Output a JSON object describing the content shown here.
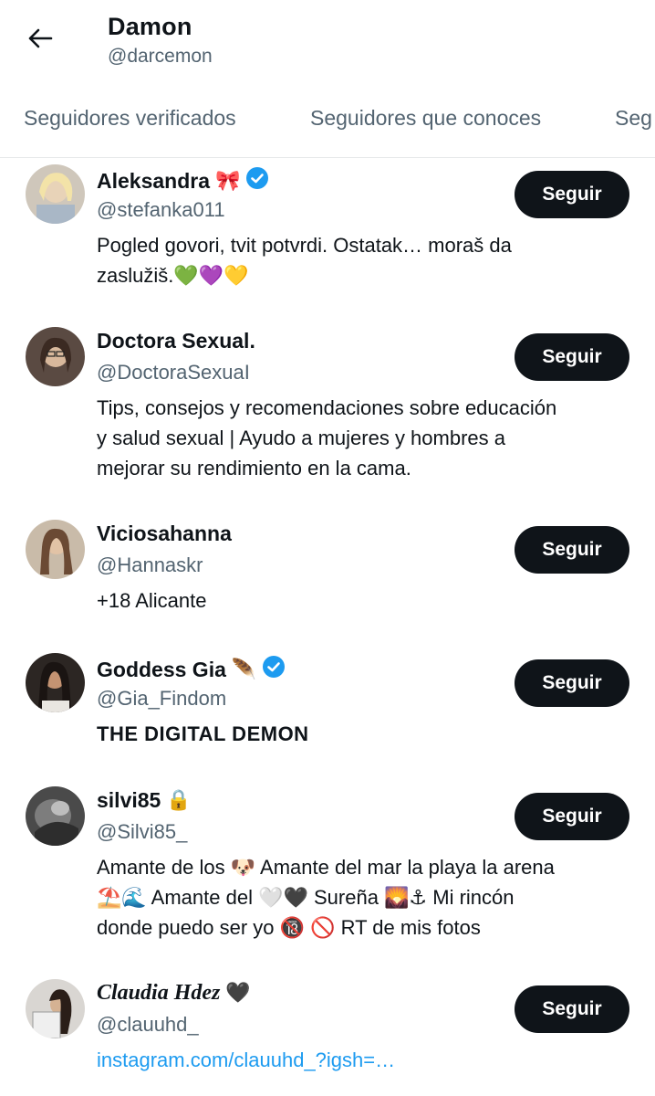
{
  "header": {
    "name": "Damon",
    "handle": "@darcemon"
  },
  "tabs": [
    {
      "label": "Seguidores verificados"
    },
    {
      "label": "Seguidores que conoces"
    },
    {
      "label": "Seg"
    }
  ],
  "follow_label": "Seguir",
  "users": [
    {
      "name": "Aleksandra",
      "name_emoji": "🎀",
      "verified": true,
      "handle": "@stefanka011",
      "bio_lines": [
        "Pogled govori, tvit potvrdi. Ostatak… moraš da",
        "zaslužiš.💚💜💛"
      ]
    },
    {
      "name": "Doctora Sexual.",
      "verified": false,
      "handle": "@DoctoraSexuaI",
      "bio_lines": [
        "Tips, consejos y recomendaciones sobre educación",
        "y salud sexual | Ayudo a mujeres y hombres a",
        "mejorar su rendimiento en la cama."
      ]
    },
    {
      "name": "Viciosahanna",
      "verified": false,
      "handle": "@Hannaskr",
      "bio_lines": [
        "+18 Alicante"
      ]
    },
    {
      "name": "Goddess Gia",
      "name_emoji": "🪶",
      "verified": true,
      "handle": "@Gia_Findom",
      "bio_lines": [
        "THE DIGITAL DEMON"
      ]
    },
    {
      "name": "silvi85",
      "name_emoji": "🔒",
      "verified": false,
      "handle": "@Silvi85_",
      "bio_lines": [
        "Amante de los 🐶 Amante del mar la playa la arena",
        "⛱️🌊 Amante del 🤍🖤 Sureña 🌄⚓ Mi rincón",
        "donde puedo ser yo 🔞 🚫 RT de mis fotos"
      ]
    },
    {
      "name": "Claudia Hdez",
      "name_emoji": "🖤",
      "verified": false,
      "handle": "@clauuhd_",
      "bio_lines": [
        "instagram.com/clauuhd_?igsh=…"
      ]
    }
  ]
}
